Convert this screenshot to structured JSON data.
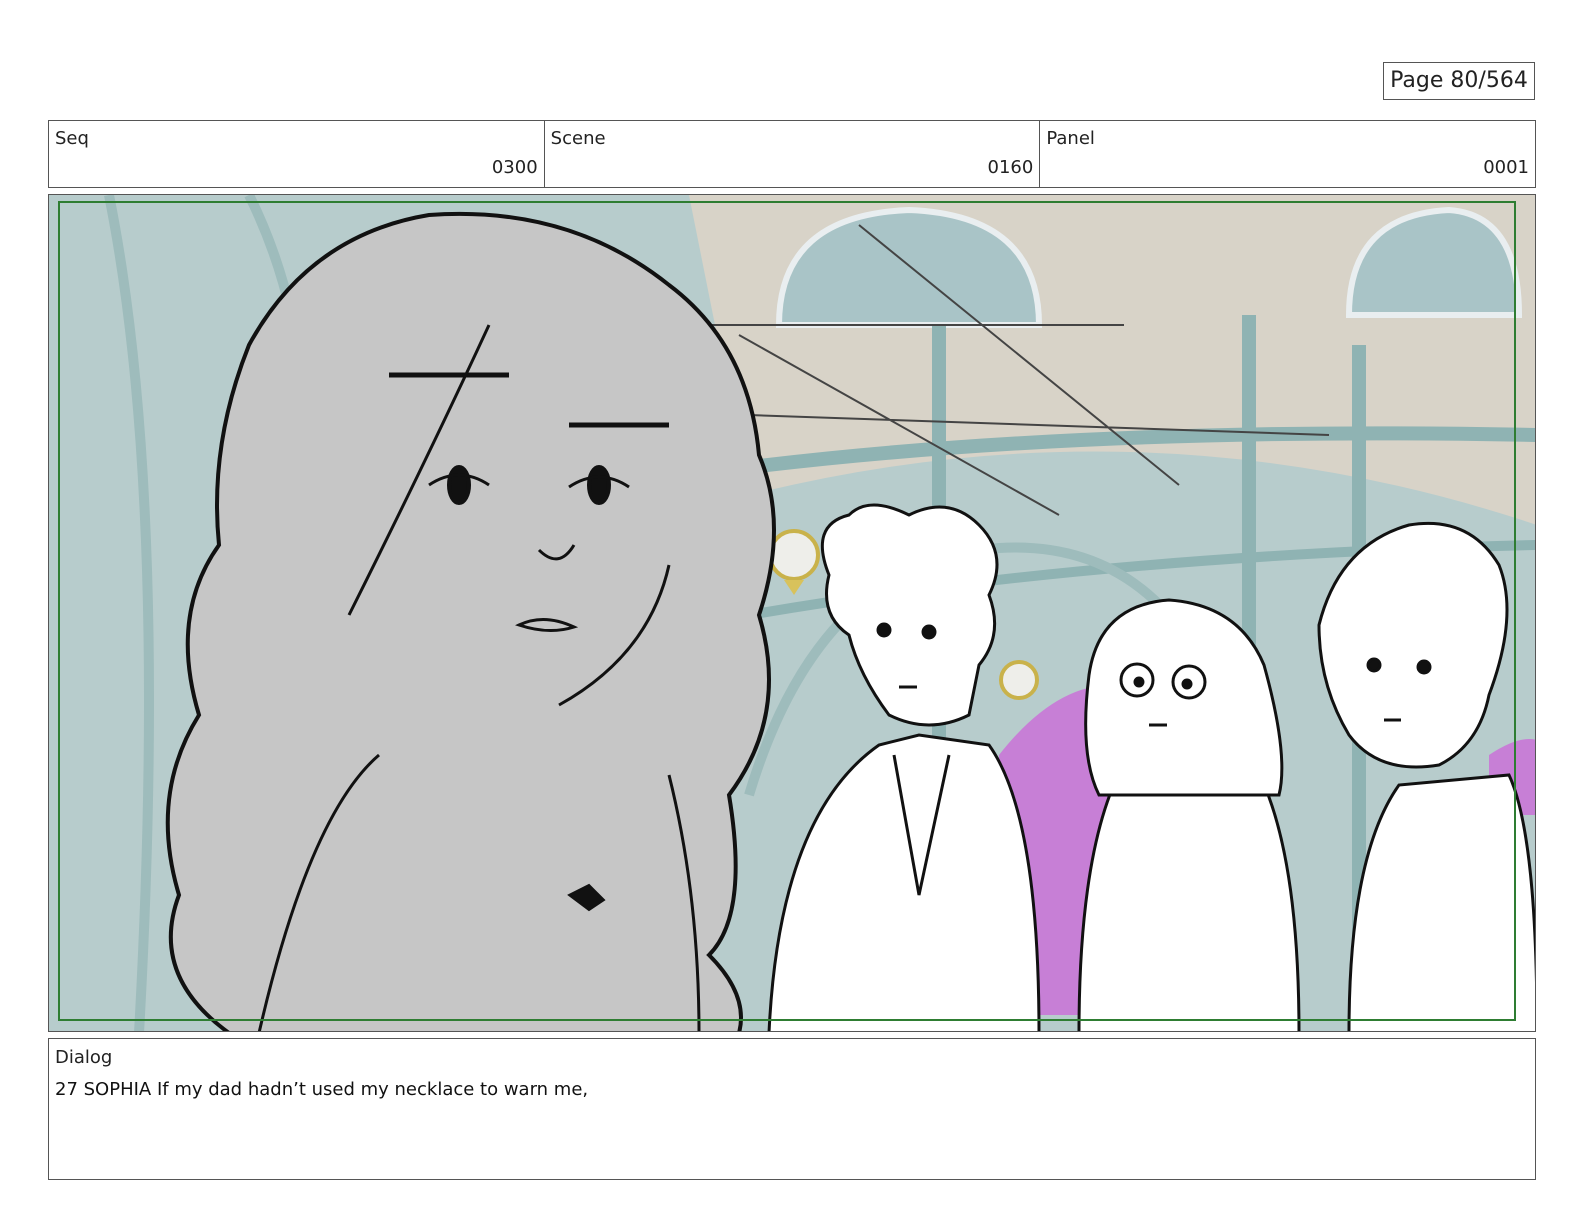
{
  "page": {
    "label": "Page",
    "value": "80/564"
  },
  "header": {
    "seq": {
      "label": "Seq",
      "value": "0300"
    },
    "scene": {
      "label": "Scene",
      "value": "0160"
    },
    "panel": {
      "label": "Panel",
      "value": "0001"
    }
  },
  "dialog": {
    "label": "Dialog",
    "text": "27 SOPHIA If my dad hadn’t used my necklace to warn me,"
  },
  "colors": {
    "frame_border": "#555555",
    "safe_area": "#2e7d32",
    "background_teal": "#b7cccc",
    "arch_purple": "#c77fd6",
    "sophia_fill": "#c6c6c6",
    "line_art": "#111111"
  }
}
